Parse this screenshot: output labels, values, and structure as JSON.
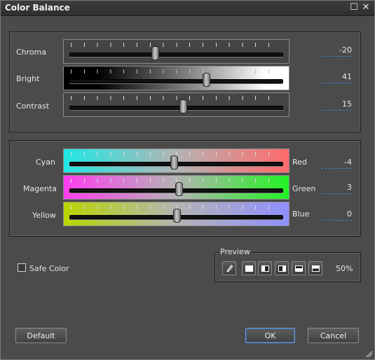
{
  "window": {
    "title": "Color Balance",
    "maximize_glyph": "☐",
    "close_glyph": "✕"
  },
  "tone": {
    "chroma": {
      "label": "Chroma",
      "value": "-20",
      "level": 0.4
    },
    "bright": {
      "label": "Bright",
      "value": "41",
      "level": 0.64
    },
    "contrast": {
      "label": "Contrast",
      "value": "15",
      "level": 0.53
    }
  },
  "balance": {
    "cyan_red": {
      "left_label": "Cyan",
      "right_label": "Red",
      "value": "-4",
      "level": 0.49,
      "from": "#1ee8e4",
      "to": "#ff6a6a"
    },
    "magenta_green": {
      "left_label": "Magenta",
      "right_label": "Green",
      "value": "3",
      "level": 0.51,
      "from": "#ff3cf0",
      "to": "#22f222"
    },
    "yellow_blue": {
      "left_label": "Yellow",
      "right_label": "Blue",
      "value": "0",
      "level": 0.5,
      "from": "#b8d600",
      "to": "#8f8fff"
    }
  },
  "safe_color": {
    "label": "Safe Color",
    "checked": false
  },
  "preview": {
    "label": "Preview",
    "zoom": "50%",
    "icons": [
      "eyedropper-icon",
      "preview-full-icon",
      "preview-split-left-icon",
      "preview-split-right-icon",
      "preview-split-bottom-icon",
      "preview-split-top-icon"
    ]
  },
  "buttons": {
    "default": "Default",
    "ok": "OK",
    "cancel": "Cancel"
  },
  "colors": {
    "dialog_bg": "#4b4b4b",
    "accent": "#3f7fcf"
  }
}
